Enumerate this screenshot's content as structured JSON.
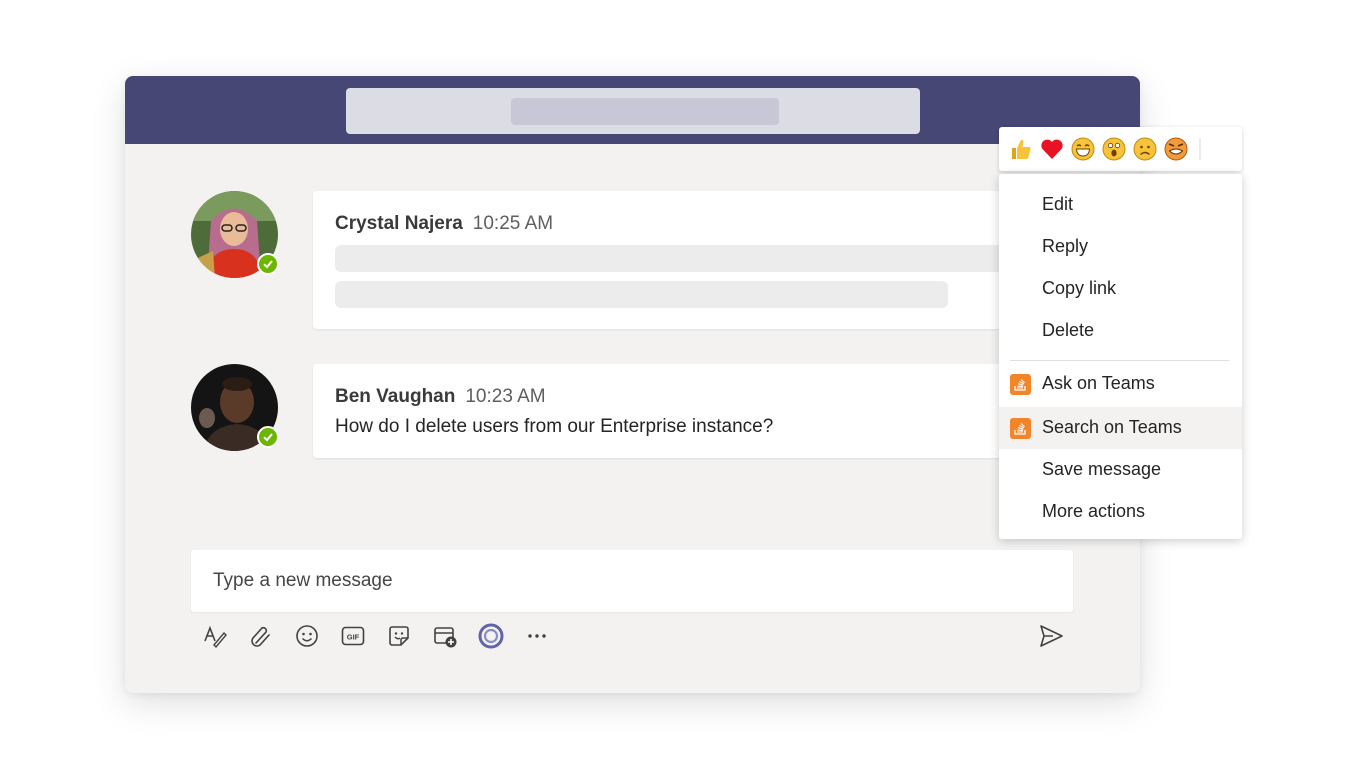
{
  "search": {
    "placeholder": ""
  },
  "messages": [
    {
      "sender": "Crystal Najera",
      "time": "10:25 AM",
      "text": "",
      "status": "available"
    },
    {
      "sender": "Ben Vaughan",
      "time": "10:23 AM",
      "text": "How do I delete users from our Enterprise instance?",
      "status": "available"
    }
  ],
  "compose": {
    "placeholder": "Type a new message",
    "toolbar": [
      "format-icon",
      "attach-icon",
      "emoji-icon",
      "gif-icon",
      "sticker-icon",
      "schedule-meeting-icon",
      "loop-icon",
      "more-options-icon",
      "send-icon"
    ]
  },
  "reactions": [
    "like",
    "heart",
    "laugh",
    "surprised",
    "sad",
    "angry"
  ],
  "context_menu": {
    "items": [
      {
        "label": "Edit"
      },
      {
        "label": "Reply"
      },
      {
        "label": "Copy link"
      },
      {
        "label": "Delete"
      },
      {
        "label": "Ask on Teams",
        "icon": "stack-overflow-icon"
      },
      {
        "label": "Search on Teams",
        "icon": "stack-overflow-icon",
        "highlighted": true
      },
      {
        "label": "Save message"
      },
      {
        "label": "More actions"
      }
    ]
  },
  "colors": {
    "header": "#464775",
    "status": "#6bb700",
    "accent": "#6264a7",
    "app_icon": "#f2842a",
    "heart": "#e81224"
  }
}
